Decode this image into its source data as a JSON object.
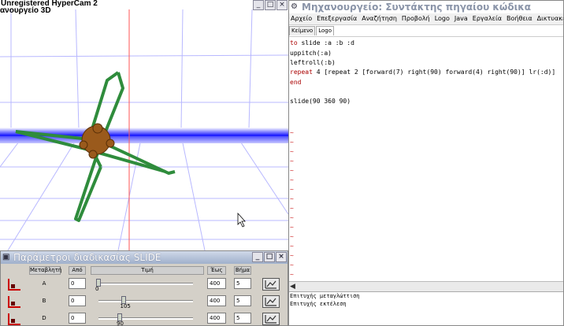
{
  "recorder_banner": "Unregistered HyperCam 2",
  "scene_window": {
    "title": "ανουργείο 3D"
  },
  "editor_window": {
    "title": "Μηχανουργείο: Συντάκτης πηγαίου κώδικα",
    "menu": [
      "Αρχείο",
      "Επεξεργασία",
      "Αναζήτηση",
      "Προβολή",
      "Logo",
      "Java",
      "Εργαλεία",
      "Βοήθεια",
      "Δικτυακές υπηρεσ"
    ],
    "tabs": [
      "Κείμενο",
      "Logo"
    ],
    "code_lines": [
      {
        "kw": "to",
        "rest": " slide :a :b :d"
      },
      {
        "kw": "",
        "rest": "uppitch(:a)"
      },
      {
        "kw": "",
        "rest": "leftroll(:b)"
      },
      {
        "kw": "repeat",
        "rest": " 4 [repeat 2 [forward(7) right(90) forward(4) right(90)] lr(:d)]"
      },
      {
        "kw": "end",
        "rest": ""
      },
      {
        "kw": "",
        "rest": ""
      },
      {
        "kw": "",
        "rest": "slide(90 360 90)"
      }
    ],
    "console": [
      "Επιτυχής μεταγλώττιση",
      "Επιτυχής εκτέλεση"
    ]
  },
  "params_window": {
    "title": "Παράμετροι διαδικασίας SLIDE",
    "headers": {
      "variable": "Μεταβλητή",
      "from": "Από",
      "value": "Τιμή",
      "to": "Έως",
      "step": "Βήμα"
    },
    "rows": [
      {
        "name": "A",
        "from": "0",
        "value": 0,
        "value_label": "0",
        "to": "400",
        "step": "5"
      },
      {
        "name": "B",
        "from": "0",
        "value": 105,
        "value_label": "105",
        "to": "400",
        "step": "5"
      },
      {
        "name": "D",
        "from": "0",
        "value": 90,
        "value_label": "90",
        "to": "400",
        "step": "5"
      }
    ]
  },
  "colors": {
    "object_green": "#2f8c3c",
    "turtle_brown": "#9a5a1c",
    "grid_blue": "#3333ff",
    "axis_red": "#ff5555"
  }
}
